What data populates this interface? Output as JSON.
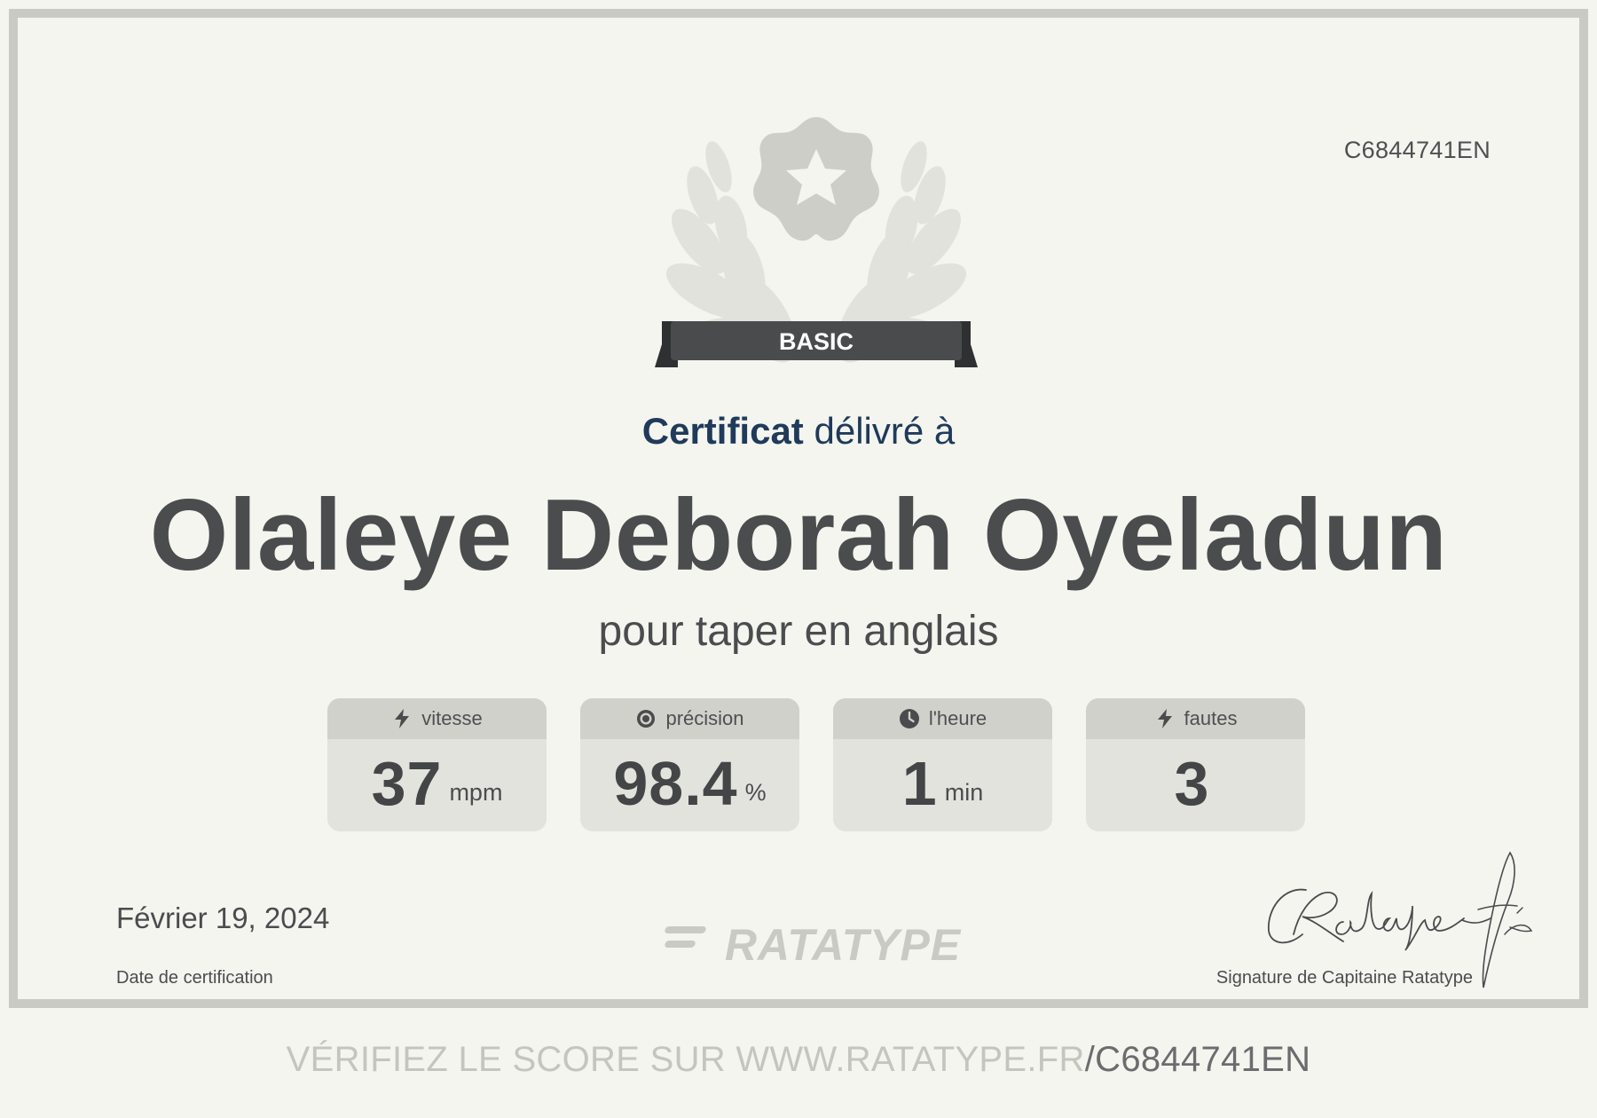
{
  "certificate": {
    "id": "C6844741EN",
    "level": "BASIC",
    "heading_strong": "Certificat",
    "heading_rest": "délivré à",
    "recipient": "Olaleye Deborah Oyeladun",
    "subtitle": "pour taper en anglais",
    "stats": [
      {
        "icon": "bolt-icon",
        "label": "vitesse",
        "value": "37",
        "unit": "mpm"
      },
      {
        "icon": "target-icon",
        "label": "précision",
        "value": "98.4",
        "unit": "%"
      },
      {
        "icon": "clock-icon",
        "label": "l'heure",
        "value": "1",
        "unit": "min"
      },
      {
        "icon": "bolt-icon",
        "label": "fautes",
        "value": "3",
        "unit": ""
      }
    ],
    "date": "Février 19, 2024",
    "date_label": "Date de certification",
    "brand": "RATATYPE",
    "signature_label": "Signature de Capitaine Ratatype"
  },
  "footer": {
    "verify_prefix": "VÉRIFIEZ LE SCORE SUR WWW.RATATYPE.FR",
    "verify_code": "/C6844741EN"
  },
  "colors": {
    "background": "#f4f5ef",
    "frame": "#c9cac4",
    "heading": "#1f3a5a",
    "text": "#4b4c4e",
    "badge_ribbon": "#4a4b4d",
    "stat_card": "#e3e3de",
    "stat_header": "#d1d1cb"
  }
}
